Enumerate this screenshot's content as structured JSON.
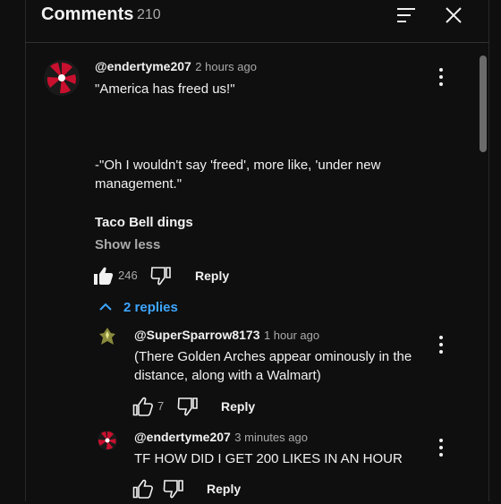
{
  "header": {
    "title": "Comments",
    "count": "210",
    "sort_icon": "sort-icon",
    "close_icon": "close-icon"
  },
  "comments": [
    {
      "username": "@endertyme207",
      "time": "2 hours ago",
      "lines": [
        "\"America has freed us!\"",
        "-\"Oh I wouldn't say 'freed', more like, 'under new",
        "management.\"",
        "Taco Bell dings"
      ],
      "show_less": "Show less",
      "likes": "246",
      "reply_label": "Reply",
      "replies_toggle": "2 replies"
    }
  ],
  "replies": [
    {
      "username": "@SuperSparrow8173",
      "time": "1 hour ago",
      "lines": [
        "(There Golden Arches appear ominously in the",
        "distance, along with a Walmart)"
      ],
      "likes": "7",
      "reply_label": "Reply"
    },
    {
      "username": "@endertyme207",
      "time": "3 minutes ago",
      "lines": [
        "TF HOW DID I GET 200 LIKES IN AN HOUR"
      ],
      "likes": "",
      "reply_label": "Reply"
    }
  ],
  "colors": {
    "background": "#0f0f0f",
    "text": "#f1f1f1",
    "muted": "#aaaaaa",
    "link": "#3ea6ff",
    "avatar_red": "#c8102e"
  }
}
